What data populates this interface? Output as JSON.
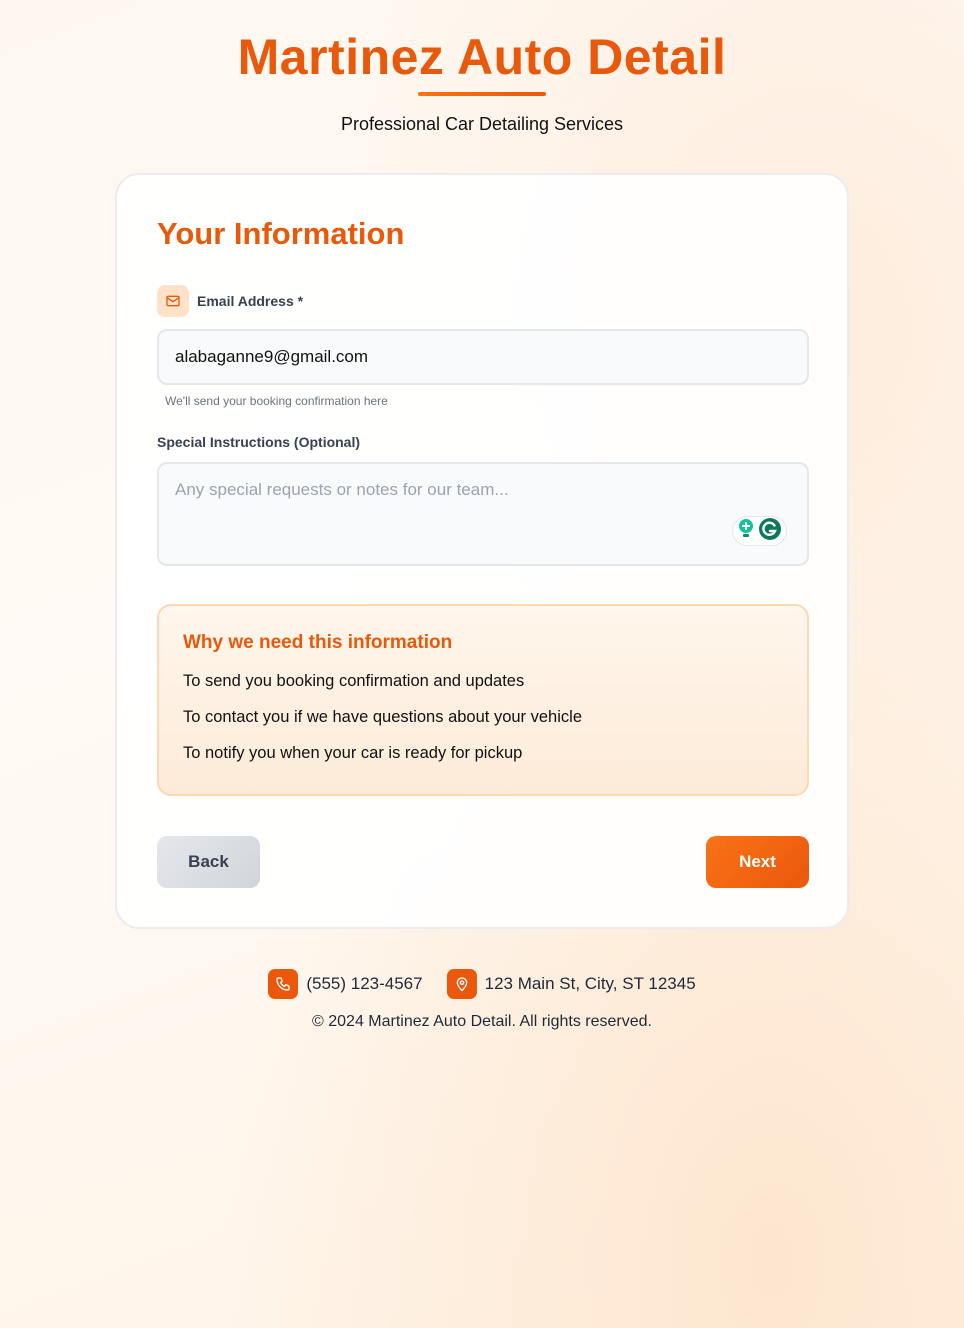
{
  "header": {
    "title": "Martinez Auto Detail",
    "subtitle": "Professional Car Detailing Services"
  },
  "form": {
    "section_title": "Your Information",
    "email": {
      "label": "Email Address *",
      "value": "alabaganne9@gmail.com",
      "hint": "We'll send your booking confirmation here",
      "icon": "mail-icon"
    },
    "instructions": {
      "label": "Special Instructions (Optional)",
      "placeholder": "Any special requests or notes for our team..."
    },
    "info": {
      "title": "Why we need this information",
      "items": [
        "To send you booking confirmation and updates",
        "To contact you if we have questions about your vehicle",
        "To notify you when your car is ready for pickup"
      ]
    },
    "buttons": {
      "back": "Back",
      "next": "Next"
    }
  },
  "footer": {
    "phone": "(555) 123-4567",
    "address": "123 Main St, City, ST 12345",
    "copyright": "© 2024 Martinez Auto Detail. All rights reserved."
  },
  "colors": {
    "accent": "#e8590c",
    "button_gradient_start": "#f97316",
    "button_gradient_end": "#ea580c"
  }
}
